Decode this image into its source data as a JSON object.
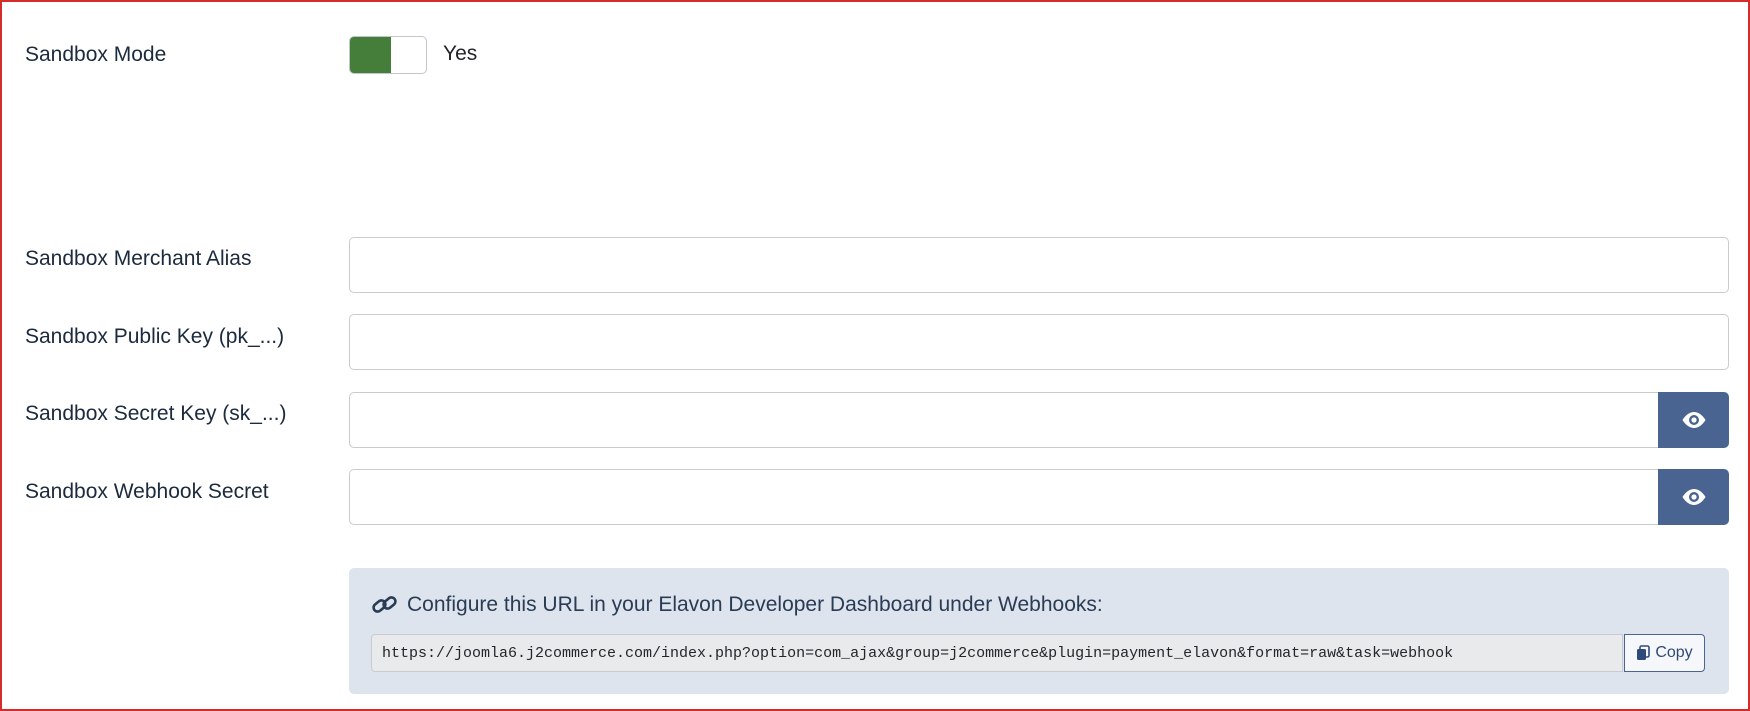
{
  "sandbox_mode": {
    "label": "Sandbox Mode",
    "state_text": "Yes",
    "on_color": "#457d3a"
  },
  "fields": {
    "merchant_alias": {
      "label": "Sandbox Merchant Alias",
      "value": ""
    },
    "public_key": {
      "label": "Sandbox Public Key (pk_...)",
      "value": ""
    },
    "secret_key": {
      "label": "Sandbox Secret Key (sk_...)",
      "value": "",
      "reveal_icon": "eye-icon"
    },
    "webhook_secret": {
      "label": "Sandbox Webhook Secret",
      "value": "",
      "reveal_icon": "eye-icon"
    }
  },
  "webhook_info": {
    "icon": "link-icon",
    "message": "Configure this URL in your Elavon Developer Dashboard under Webhooks:",
    "url": "https://joomla6.j2commerce.com/index.php?option=com_ajax&group=j2commerce&plugin=payment_elavon&format=raw&task=webhook",
    "copy_label": "Copy",
    "copy_icon": "copy-icon"
  },
  "colors": {
    "accent_button": "#4a6491",
    "info_background": "#dde4ee",
    "frame_border": "#d42b2b"
  }
}
